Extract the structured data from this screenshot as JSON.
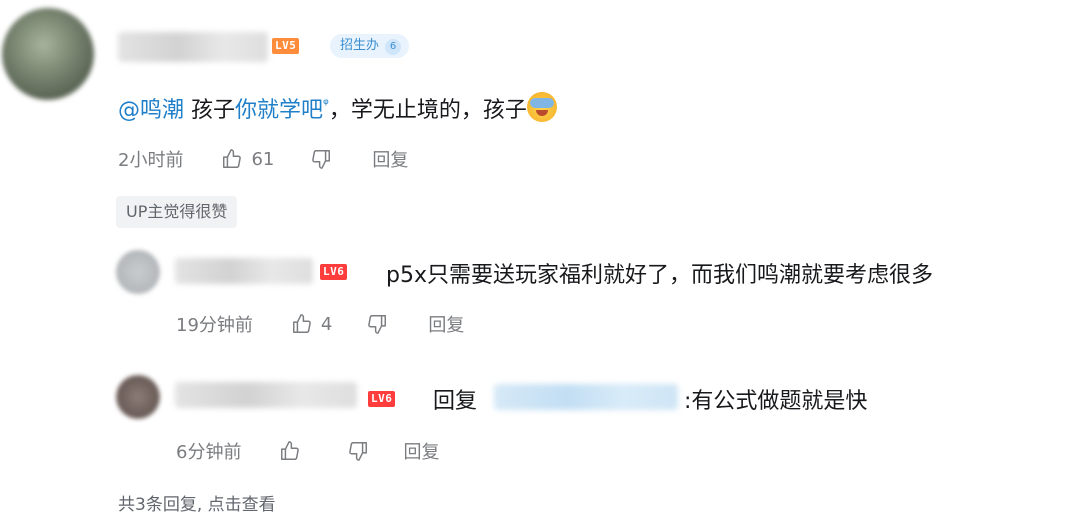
{
  "comment": {
    "level_badge": "LV5",
    "fan_badge": {
      "label": "招生办",
      "count": "6"
    },
    "mention": "@鸣潮",
    "text_before_link": " 孩子",
    "link_text": "你就学吧",
    "search_glyph": "ᵠ",
    "text_after_link": "，学无止境的，孩子",
    "time": "2小时前",
    "likes": "61",
    "reply_label": "回复",
    "up_tag": "UP主觉得很赞"
  },
  "replies": [
    {
      "level_badge": "LV6",
      "text": "p5x只需要送玩家福利就好了，而我们鸣潮就要考虑很多",
      "time": "19分钟前",
      "likes": "4",
      "reply_label": "回复"
    },
    {
      "level_badge": "LV6",
      "reply_prefix": "回复",
      "text": ":有公式做题就是快",
      "time": "6分钟前",
      "likes": "",
      "reply_label": "回复"
    }
  ],
  "view_more": "共3条回复, 点击查看",
  "colors": {
    "link": "#1f7fc9",
    "meta": "#7a7c80",
    "lv5": "#ff8c3b",
    "lv6": "#ff3d3d",
    "fan_badge_bg": "#e8f3fd"
  }
}
